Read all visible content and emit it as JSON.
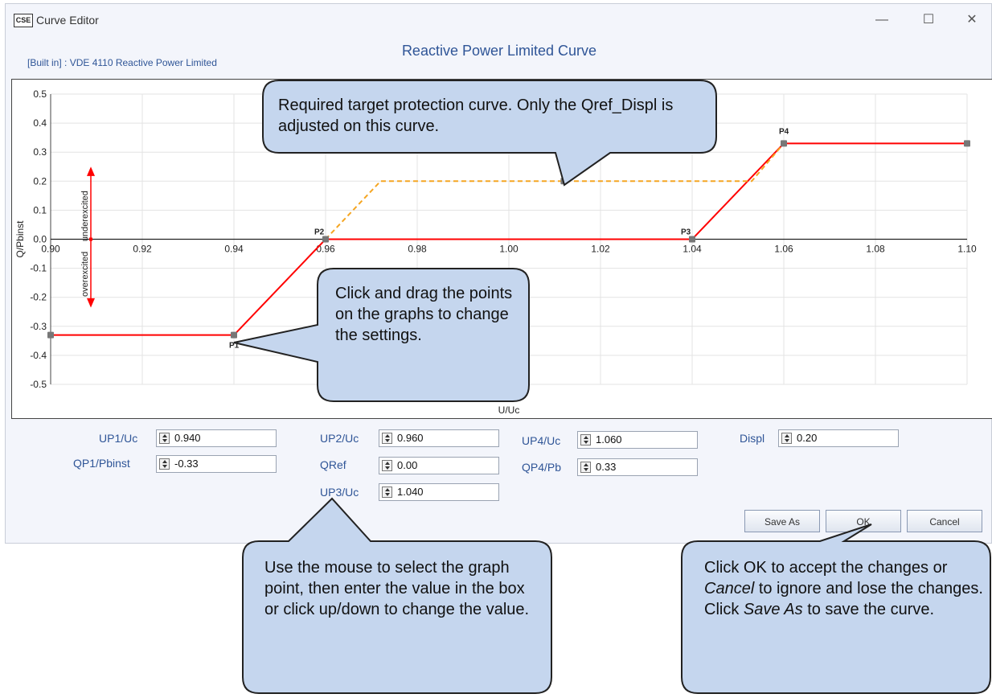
{
  "window": {
    "icon_text": "CSE",
    "title": "Curve Editor",
    "controls": {
      "minimize": "—",
      "maximize": "☐",
      "close": "✕"
    }
  },
  "dialog": {
    "title": "Reactive Power Limited Curve",
    "builtin": "[Built in] : VDE 4110 Reactive Power Limited"
  },
  "chart_data": {
    "type": "line",
    "xlabel": "U/Uc",
    "ylabel": "Q/Pbinst",
    "xlim": [
      0.9,
      1.1
    ],
    "ylim": [
      -0.5,
      0.5
    ],
    "x_ticks": [
      "0.90",
      "0.92",
      "0.94",
      "0.96",
      "0.98",
      "1.00",
      "1.02",
      "1.04",
      "1.06",
      "1.08",
      "1.10"
    ],
    "y_ticks": [
      "0.5",
      "0.4",
      "0.3",
      "0.2",
      "0.1",
      "0.0",
      "-0.1",
      "-0.2",
      "-0.3",
      "-0.4",
      "-0.5"
    ],
    "series": [
      {
        "color": "#ff0000",
        "style": "solid",
        "x": [
          0.9,
          0.94,
          0.96,
          1.04,
          1.06,
          1.1
        ],
        "y": [
          -0.33,
          -0.33,
          0.0,
          0.0,
          0.33,
          0.33
        ]
      },
      {
        "color": "#f5a623",
        "style": "dashed",
        "x": [
          0.96,
          0.972,
          1.053,
          1.06
        ],
        "y": [
          0.0,
          0.2,
          0.2,
          0.33
        ]
      }
    ],
    "point_labels": [
      {
        "name": "P1",
        "x": 0.94,
        "y": -0.33
      },
      {
        "name": "P2",
        "x": 0.96,
        "y": 0.0
      },
      {
        "name": "P3",
        "x": 1.04,
        "y": 0.0
      },
      {
        "name": "P4",
        "x": 1.06,
        "y": 0.33
      }
    ],
    "annotations": {
      "underexcited": "underexcited",
      "overexcited": "overexcited"
    }
  },
  "fields": {
    "up1": {
      "label": "UP1/Uc",
      "value": "0.940"
    },
    "qp1": {
      "label": "QP1/Pbinst",
      "value": "-0.33"
    },
    "up2": {
      "label": "UP2/Uc",
      "value": "0.960"
    },
    "qref": {
      "label": "QRef",
      "value": "0.00"
    },
    "up3": {
      "label": "UP3/Uc",
      "value": "1.040"
    },
    "up4": {
      "label": "UP4/Uc",
      "value": "1.060"
    },
    "qp4": {
      "label": "QP4/Pb",
      "value": "0.33"
    },
    "displ": {
      "label": "Displ",
      "value": "0.20"
    }
  },
  "buttons": {
    "save_as": "Save As",
    "ok": "OK",
    "cancel": "Cancel"
  },
  "callouts": {
    "target_curve": "Required target protection curve. Only the Qref_Displ is adjusted on this curve.",
    "drag_points": "Click and drag the points on the graphs to change the settings.",
    "enter_value": "Use the mouse to select the graph point, then enter the value in the box or click up/down to change the value.",
    "ok_cancel_pre": "Click OK to accept the changes or ",
    "ok_cancel_cancel": "Cancel",
    "ok_cancel_mid": " to ignore and lose the changes. Click ",
    "ok_cancel_saveas": "Save As",
    "ok_cancel_post": " to save the curve."
  },
  "colors": {
    "accent": "#2f5597",
    "curve": "#ff0000",
    "target_curve": "#f5a623",
    "callout_fill": "#c5d6ee"
  }
}
